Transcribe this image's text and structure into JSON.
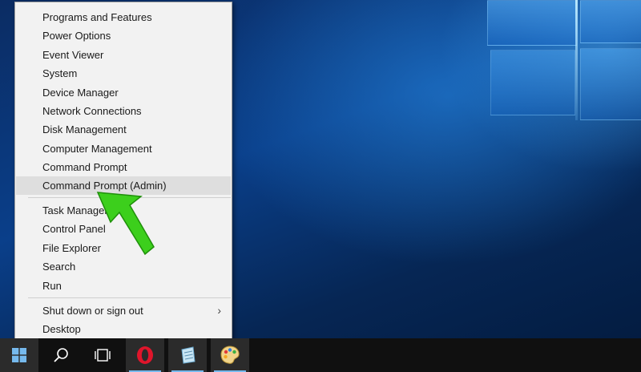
{
  "context_menu": {
    "items": [
      {
        "label": "Programs and Features"
      },
      {
        "label": "Power Options"
      },
      {
        "label": "Event Viewer"
      },
      {
        "label": "System"
      },
      {
        "label": "Device Manager"
      },
      {
        "label": "Network Connections"
      },
      {
        "label": "Disk Management"
      },
      {
        "label": "Computer Management"
      },
      {
        "label": "Command Prompt"
      },
      {
        "label": "Command Prompt (Admin)",
        "highlighted": true
      },
      {
        "label": "Task Manager"
      },
      {
        "label": "Control Panel"
      },
      {
        "label": "File Explorer"
      },
      {
        "label": "Search"
      },
      {
        "label": "Run"
      },
      {
        "label": "Shut down or sign out",
        "has_submenu": true
      },
      {
        "label": "Desktop"
      }
    ]
  },
  "taskbar": {
    "icons": [
      "windows-start-icon",
      "search-icon",
      "task-view-icon",
      "opera-browser-icon",
      "notepad-icon",
      "paint-icon"
    ]
  },
  "colors": {
    "menu_bg": "#f2f2f2",
    "highlight": "#dedede",
    "taskbar_bg": "#101010",
    "start_blue": "#0078d7",
    "arrow_green": "#3ccf1c"
  }
}
